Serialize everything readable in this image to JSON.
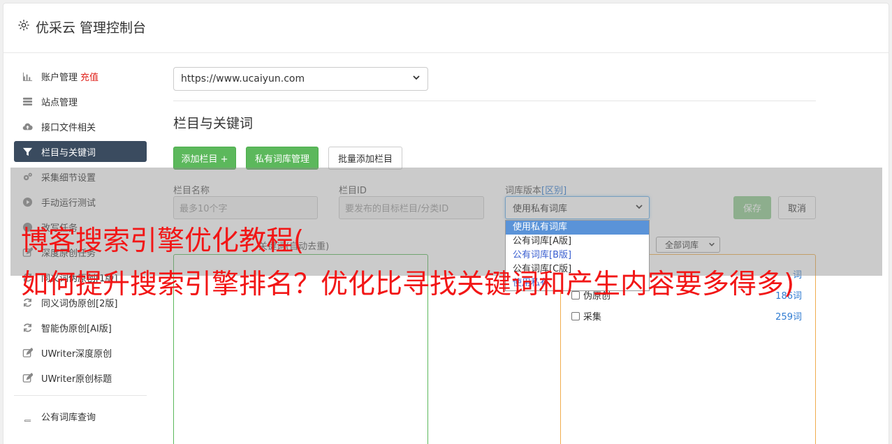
{
  "app": {
    "title": "优采云 管理控制台"
  },
  "sidebar": {
    "items": [
      {
        "label": "账户管理",
        "badge": "充值",
        "icon": "bar-chart-icon"
      },
      {
        "label": "站点管理",
        "icon": "server-icon"
      },
      {
        "label": "接口文件相关",
        "icon": "cloud-upload-icon"
      },
      {
        "label": "栏目与关键词",
        "icon": "filter-icon",
        "active": true
      },
      {
        "label": "采集细节设置",
        "icon": "gears-icon"
      },
      {
        "label": "手动运行测试",
        "icon": "play-circle-icon"
      },
      {
        "label": "改写任务",
        "icon": "chart-icon"
      },
      {
        "label": "深度原创任务",
        "icon": "edit-icon"
      },
      {
        "label": "同义词伪原创[1版]",
        "icon": "refresh-icon"
      },
      {
        "label": "同义词伪原创[2版]",
        "icon": "refresh-icon"
      },
      {
        "label": "智能伪原创[AI版]",
        "icon": "refresh-icon"
      },
      {
        "label": "UWriter深度原创",
        "icon": "edit-icon"
      },
      {
        "label": "UWriter原创标题",
        "icon": "edit-icon"
      }
    ],
    "bottom_items": [
      {
        "label": "公有词库查询",
        "icon": "book-icon"
      }
    ]
  },
  "main": {
    "site_select": {
      "value": "https://www.ucaiyun.com"
    },
    "section_title": "栏目与关键词",
    "buttons": {
      "add": "添加栏目 +",
      "private": "私有词库管理",
      "batch": "批量添加栏目"
    },
    "form": {
      "name_label": "栏目名称",
      "name_placeholder": "最多10个字",
      "id_label": "栏目ID",
      "id_placeholder": "要发布的目标栏目/分类ID",
      "lib_label": "词库版本",
      "lib_label_link": "[区别]",
      "lib_value": "使用私有词库",
      "save": "保存",
      "cancel": "取消"
    },
    "dropdown_options": [
      {
        "label": "使用私有词库",
        "selected": true
      },
      {
        "label": "公有词库[A版]"
      },
      {
        "label": "公有词库[B版]",
        "blue": true
      },
      {
        "label": "公有词库[C版]"
      },
      {
        "label": "使用私有"
      }
    ],
    "left_panel_caption": "关键词(自动去重)",
    "right_select": "全部词库",
    "keyword_rows": [
      {
        "label": "",
        "count": "词"
      },
      {
        "label": "伪原创",
        "count": "186词"
      },
      {
        "label": "采集",
        "count": "259词"
      }
    ]
  },
  "watermark": {
    "line1": "博客搜索引擎优化教程(",
    "line2": "如何提升搜索引擎排名？优化比寻找关键词和产生内容要多得多)"
  },
  "colors": {
    "accent_dark": "#3a4b5f",
    "green": "#5cb85c",
    "recharge_red": "#e0221b",
    "watermark_red": "#f21616"
  }
}
